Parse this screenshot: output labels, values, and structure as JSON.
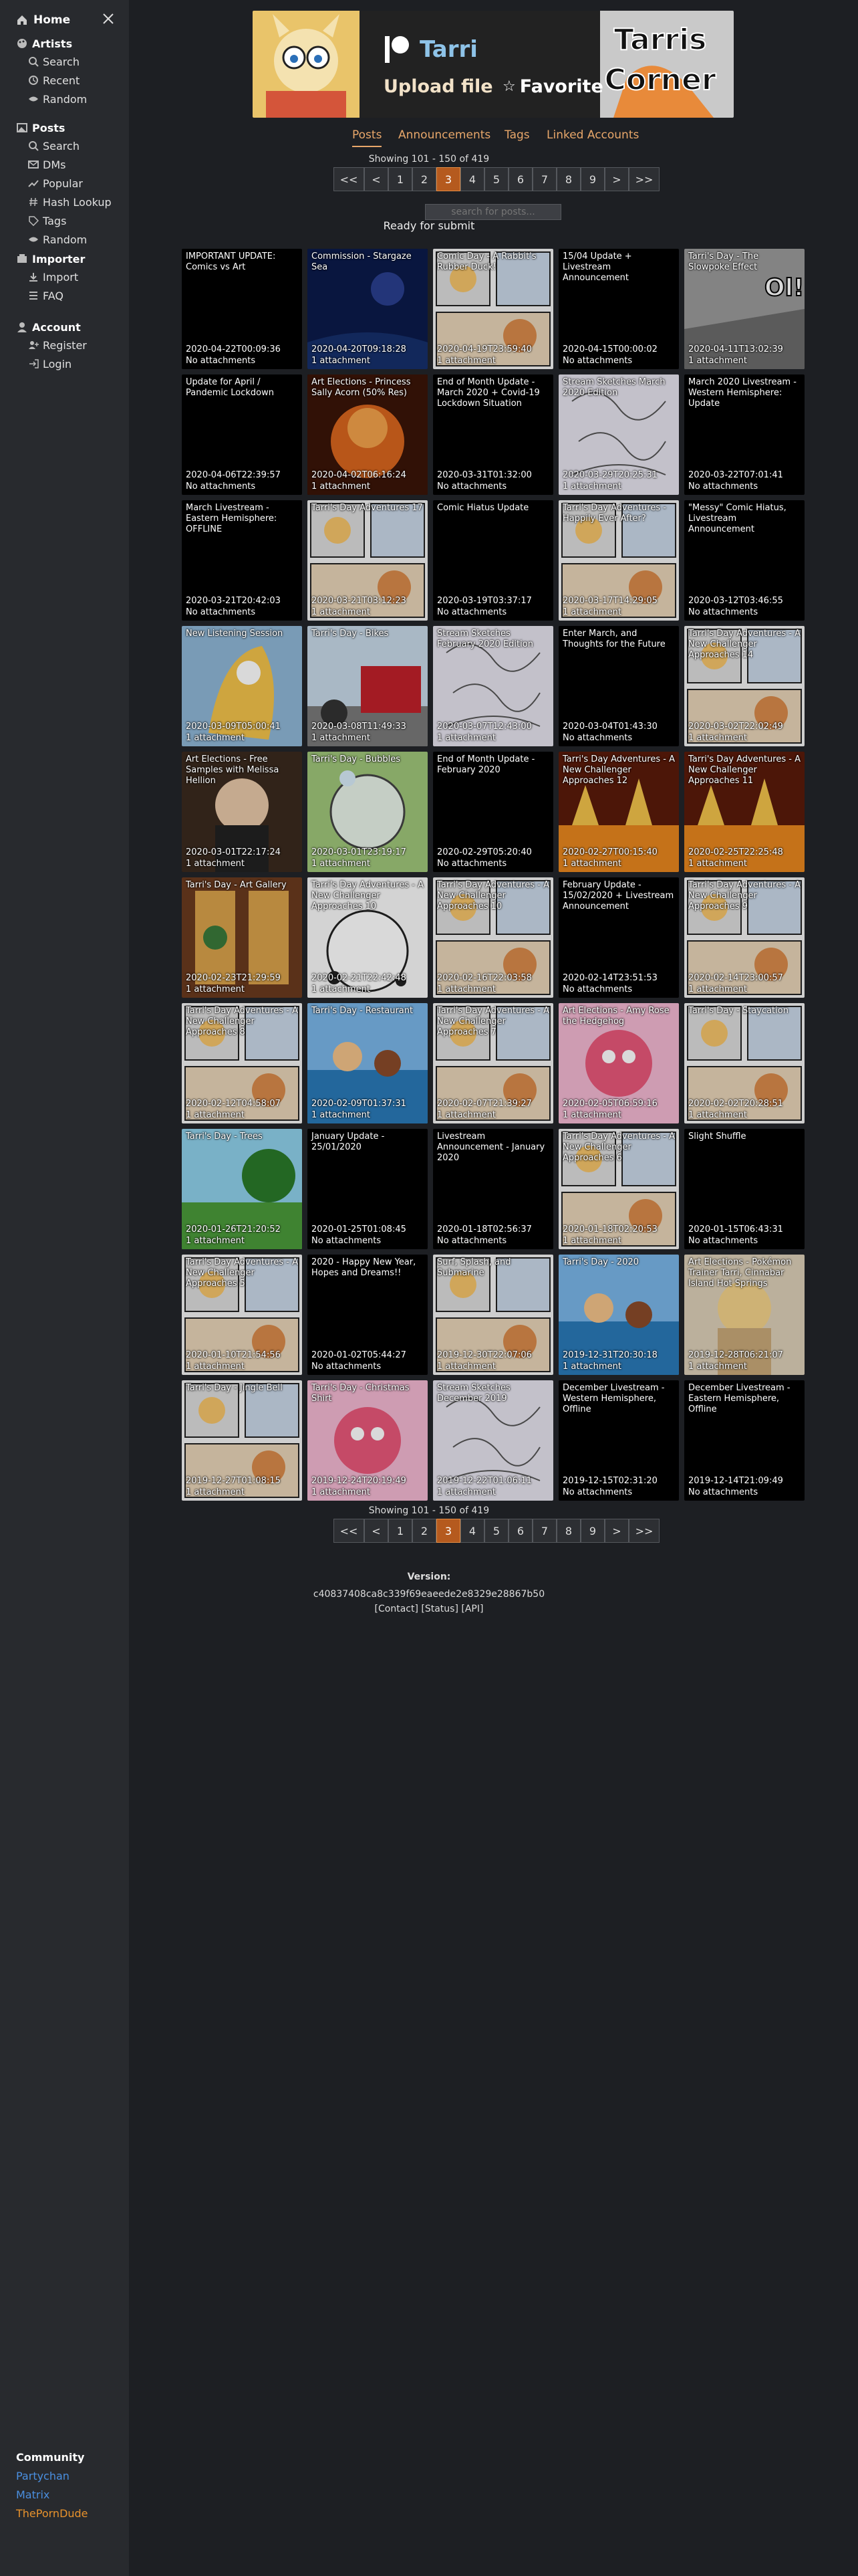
{
  "sidebar": {
    "home": "Home",
    "sections": [
      {
        "title": "Artists",
        "icon": "palette-icon",
        "items": [
          {
            "label": "Search",
            "icon": "search-icon"
          },
          {
            "label": "Recent",
            "icon": "clock-icon"
          },
          {
            "label": "Random",
            "icon": "shuffle-icon"
          }
        ]
      },
      {
        "title": "Posts",
        "icon": "image-icon",
        "items": [
          {
            "label": "Search",
            "icon": "search-icon"
          },
          {
            "label": "DMs",
            "icon": "mail-icon"
          },
          {
            "label": "Popular",
            "icon": "trend-icon"
          },
          {
            "label": "Hash Lookup",
            "icon": "hash-icon"
          },
          {
            "label": "Tags",
            "icon": "tag-icon"
          },
          {
            "label": "Random",
            "icon": "shuffle-icon"
          }
        ]
      },
      {
        "title": "Importer",
        "icon": "importer-icon",
        "items": [
          {
            "label": "Import",
            "icon": "import-icon"
          },
          {
            "label": "FAQ",
            "icon": "faq-icon"
          }
        ]
      },
      {
        "title": "Account",
        "icon": "account-icon",
        "items": [
          {
            "label": "Register",
            "icon": "register-icon"
          },
          {
            "label": "Login",
            "icon": "login-icon"
          }
        ]
      }
    ],
    "community": {
      "title": "Community",
      "links": [
        {
          "label": "Partychan",
          "color": "#4a8fe0"
        },
        {
          "label": "Matrix",
          "color": "#4a8fe0"
        },
        {
          "label": "ThePornDude",
          "color": "#e8922c"
        }
      ]
    }
  },
  "banner": {
    "service_icon": "patreon-icon",
    "artist_name": "Tarri",
    "upload_label": "Upload file",
    "favorite_label": "Favorite",
    "logo_text": "Tarris Corner"
  },
  "tabs": [
    {
      "label": "Posts",
      "active": true
    },
    {
      "label": "Announcements"
    },
    {
      "label": "Tags"
    },
    {
      "label": "Linked Accounts"
    }
  ],
  "showing": "Showing 101 - 150 of 419",
  "pagination": [
    "<<",
    "<",
    "1",
    "2",
    "3",
    "4",
    "5",
    "6",
    "7",
    "8",
    "9",
    ">",
    ">>"
  ],
  "current_page": "3",
  "search": {
    "placeholder": "search for posts..."
  },
  "status": "Ready for submit",
  "posts": [
    {
      "title": "IMPORTANT UPDATE: Comics vs Art",
      "date": "2020-04-22T00:09:36",
      "attachments": "No attachments",
      "thumb": "none"
    },
    {
      "title": "Commission - Stargaze Sea",
      "date": "2020-04-20T09:18:28",
      "attachments": "1 attachment",
      "thumb": "night"
    },
    {
      "title": "Comic Day - A Rabbit's Rubber Duck!",
      "date": "2020-04-19T23:59:40",
      "attachments": "1 attachment",
      "thumb": "comic"
    },
    {
      "title": "15/04 Update + Livestream Announcement",
      "date": "2020-04-15T00:00:02",
      "attachments": "No attachments",
      "thumb": "none"
    },
    {
      "title": "Tarri's Day - The Slowpoke Effect",
      "date": "2020-04-11T13:02:39",
      "attachments": "1 attachment",
      "thumb": "grey"
    },
    {
      "title": "Update for April / Pandemic Lockdown",
      "date": "2020-04-06T22:39:57",
      "attachments": "No attachments",
      "thumb": "none"
    },
    {
      "title": "Art Elections - Princess Sally Acorn (50% Res)",
      "date": "2020-04-02T06:16:24",
      "attachments": "1 attachment",
      "thumb": "orange"
    },
    {
      "title": "End of Month Update - March 2020 + Covid-19 Lockdown Situation",
      "date": "2020-03-31T01:32:00",
      "attachments": "No attachments",
      "thumb": "none"
    },
    {
      "title": "Stream Sketches March 2020 Edition",
      "date": "2020-03-29T20:25:31",
      "attachments": "1 attachment",
      "thumb": "sketch"
    },
    {
      "title": "March 2020 Livestream - Western Hemisphere: Update",
      "date": "2020-03-22T07:01:41",
      "attachments": "No attachments",
      "thumb": "none"
    },
    {
      "title": "March Livestream - Eastern Hemisphere: OFFLINE",
      "date": "2020-03-21T20:42:03",
      "attachments": "No attachments",
      "thumb": "none"
    },
    {
      "title": "Tarri's Day Adventures 17",
      "date": "2020-03-21T03:12:23",
      "attachments": "1 attachment",
      "thumb": "comic"
    },
    {
      "title": "Comic Hiatus Update",
      "date": "2020-03-19T03:37:17",
      "attachments": "No attachments",
      "thumb": "none"
    },
    {
      "title": "Tarri's Day Adventures - Happily Ever After?",
      "date": "2020-03-17T14:29:05",
      "attachments": "1 attachment",
      "thumb": "comic"
    },
    {
      "title": "\"Messy\" Comic Hiatus, Livestream Announcement",
      "date": "2020-03-12T03:46:55",
      "attachments": "No attachments",
      "thumb": "none"
    },
    {
      "title": "New Listening Session",
      "date": "2020-03-09T05:00:41",
      "attachments": "1 attachment",
      "thumb": "yellow"
    },
    {
      "title": "Tarri's Day - Bikes",
      "date": "2020-03-08T11:49:33",
      "attachments": "1 attachment",
      "thumb": "bikes"
    },
    {
      "title": "Stream Sketches February 2020 Edition",
      "date": "2020-03-07T12:43:00",
      "attachments": "1 attachment",
      "thumb": "sketch"
    },
    {
      "title": "Enter March, and Thoughts for the Future",
      "date": "2020-03-04T01:43:30",
      "attachments": "No attachments",
      "thumb": "none"
    },
    {
      "title": "Tarri's Day Adventures - A New Challenger Approaches 14",
      "date": "2020-03-02T22:02:49",
      "attachments": "1 attachment",
      "thumb": "comic"
    },
    {
      "title": "Art Elections - Free Samples with Melissa Hellion",
      "date": "2020-03-01T22:17:24",
      "attachments": "1 attachment",
      "thumb": "brown"
    },
    {
      "title": "Tarri's Day - Bubbles",
      "date": "2020-03-01T23:19:17",
      "attachments": "1 attachment",
      "thumb": "green"
    },
    {
      "title": "End of Month Update - February 2020",
      "date": "2020-02-29T05:20:40",
      "attachments": "No attachments",
      "thumb": "none"
    },
    {
      "title": "Tarri's Day Adventures - A New Challenger Approaches 12",
      "date": "2020-02-27T00:15:40",
      "attachments": "1 attachment",
      "thumb": "fire"
    },
    {
      "title": "Tarri's Day Adventures - A New Challenger Approaches 11",
      "date": "2020-02-25T22:25:48",
      "attachments": "1 attachment",
      "thumb": "fire"
    },
    {
      "title": "Tarri's Day - Art Gallery",
      "date": "2020-02-23T21:29:59",
      "attachments": "1 attachment",
      "thumb": "gallery"
    },
    {
      "title": "Tarri's Day Adventures - A New Challenger Approaches 10",
      "date": "2020-02-21T22:42:48",
      "attachments": "1 attachment",
      "thumb": "white"
    },
    {
      "title": "Tarri's Day Adventures - A New Challenger Approaches 10",
      "date": "2020-02-16T22:03:58",
      "attachments": "1 attachment",
      "thumb": "comic"
    },
    {
      "title": "February Update - 15/02/2020 + Livestream Announcement",
      "date": "2020-02-14T23:51:53",
      "attachments": "No attachments",
      "thumb": "none"
    },
    {
      "title": "Tarri's Day Adventures - A New Challenger Approaches 9",
      "date": "2020-02-14T23:00:57",
      "attachments": "1 attachment",
      "thumb": "comic"
    },
    {
      "title": "Tarri's Day Adventures - A New Challenger Approaches 8",
      "date": "2020-02-12T04:58:07",
      "attachments": "1 attachment",
      "thumb": "comic"
    },
    {
      "title": "Tarri's Day - Restaurant",
      "date": "2020-02-09T01:37:31",
      "attachments": "1 attachment",
      "thumb": "sea"
    },
    {
      "title": "Tarri's Day Adventures - A New Challenger Approaches 7",
      "date": "2020-02-07T21:39:27",
      "attachments": "1 attachment",
      "thumb": "comic"
    },
    {
      "title": "Art Elections - Amy Rose the Hedgehog",
      "date": "2020-02-05T06:59:16",
      "attachments": "1 attachment",
      "thumb": "pink"
    },
    {
      "title": "Tarri's Day - Staycation",
      "date": "2020-02-02T20:28:51",
      "attachments": "1 attachment",
      "thumb": "comic"
    },
    {
      "title": "Tarri's Day - Trees",
      "date": "2020-01-26T21:20:52",
      "attachments": "1 attachment",
      "thumb": "trees"
    },
    {
      "title": "January Update - 25/01/2020",
      "date": "2020-01-25T01:08:45",
      "attachments": "No attachments",
      "thumb": "none"
    },
    {
      "title": "Livestream Announcement - January 2020",
      "date": "2020-01-18T02:56:37",
      "attachments": "No attachments",
      "thumb": "none"
    },
    {
      "title": "Tarri's Day Adventures - A New Challenger Approaches 6",
      "date": "2020-01-18T02:20:53",
      "attachments": "1 attachment",
      "thumb": "comic"
    },
    {
      "title": "Slight Shuffle",
      "date": "2020-01-15T06:43:31",
      "attachments": "No attachments",
      "thumb": "none"
    },
    {
      "title": "Tarri's Day Adventures - A New Challenger Approaches 5",
      "date": "2020-01-10T21:54:56",
      "attachments": "1 attachment",
      "thumb": "comic"
    },
    {
      "title": "2020 - Happy New Year, Hopes and Dreams!!",
      "date": "2020-01-02T05:44:27",
      "attachments": "No attachments",
      "thumb": "none"
    },
    {
      "title": "Surf, Splash, and Submarine",
      "date": "2019-12-30T22:07:06",
      "attachments": "1 attachment",
      "thumb": "comic"
    },
    {
      "title": "Tarri's Day - 2020",
      "date": "2019-12-31T20:30:18",
      "attachments": "1 attachment",
      "thumb": "sea"
    },
    {
      "title": "Art Elections - Pokémon Trainer Tarri, Cinnabar Island Hot Springs",
      "date": "2019-12-28T06:21:07",
      "attachments": "1 attachment",
      "thumb": "tan"
    },
    {
      "title": "Tarri's Day - Jingle Bell",
      "date": "2019-12-27T01:08:15",
      "attachments": "1 attachment",
      "thumb": "comic"
    },
    {
      "title": "Tarri's Day - Christmas Shirt",
      "date": "2019-12-24T20:19:49",
      "attachments": "1 attachment",
      "thumb": "pink"
    },
    {
      "title": "Stream Sketches December 2019",
      "date": "2019-12-22T01:06:11",
      "attachments": "1 attachment",
      "thumb": "sketch"
    },
    {
      "title": "December Livestream - Western Hemisphere, Offline",
      "date": "2019-12-15T02:31:20",
      "attachments": "No attachments",
      "thumb": "none"
    },
    {
      "title": "December Livestream - Eastern Hemisphere, Offline",
      "date": "2019-12-14T21:09:49",
      "attachments": "No attachments",
      "thumb": "none"
    }
  ],
  "footer": {
    "version_label": "Version:",
    "version_hash": "c40837408ca8c339f69eaeede2e8329e28867b50",
    "links": [
      "[Contact]",
      "[Status]",
      "[API]"
    ]
  }
}
